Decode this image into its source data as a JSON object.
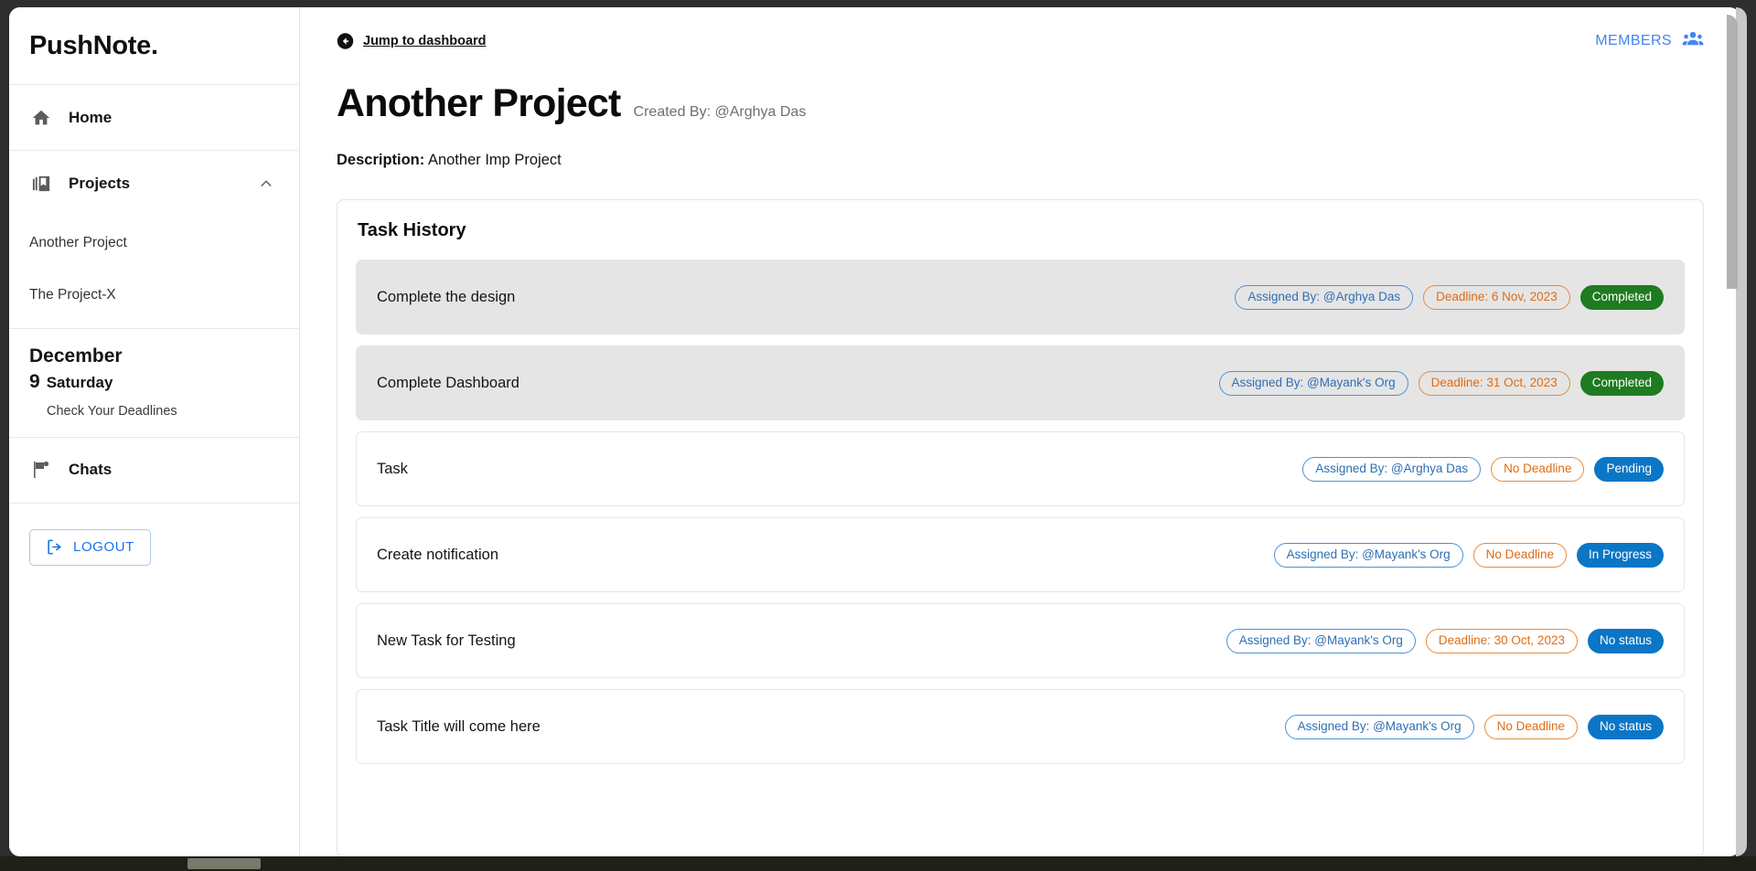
{
  "brand": {
    "name": "PushNote."
  },
  "sidebar": {
    "home": {
      "label": "Home",
      "icon": "home-icon"
    },
    "projects": {
      "label": "Projects",
      "icon": "library-books-icon",
      "chevron": "chevron-up-icon"
    },
    "project_items": [
      {
        "label": "Another Project"
      },
      {
        "label": "The Project-X"
      }
    ],
    "date": {
      "month": "December",
      "day_number": "9",
      "day_name": "Saturday",
      "note": "Check Your Deadlines"
    },
    "chats": {
      "label": "Chats",
      "icon": "chat-flag-icon"
    },
    "logout": {
      "label": "LOGOUT",
      "icon": "logout-icon"
    }
  },
  "topbar": {
    "jump_link": "Jump to dashboard",
    "back_icon": "arrow-back-circle-icon",
    "members_label": "MEMBERS",
    "members_icon": "people-group-icon"
  },
  "header": {
    "project_title": "Another Project",
    "created_by": "Created By: @Arghya Das",
    "description_label": "Description:",
    "description_value": "Another Imp Project"
  },
  "task_card": {
    "title": "Task History",
    "rows": [
      {
        "title": "Complete the design",
        "assigned": "Assigned By: @Arghya Das",
        "deadline": "Deadline: 6 Nov, 2023",
        "status": "Completed",
        "status_class": "st-completed",
        "row_class": "done"
      },
      {
        "title": "Complete Dashboard",
        "assigned": "Assigned By: @Mayank's Org",
        "deadline": "Deadline: 31 Oct, 2023",
        "status": "Completed",
        "status_class": "st-completed",
        "row_class": "done"
      },
      {
        "title": "Task",
        "assigned": "Assigned By: @Arghya Das",
        "deadline": "No Deadline",
        "status": "Pending",
        "status_class": "st-pending",
        "row_class": "open"
      },
      {
        "title": "Create notification",
        "assigned": "Assigned By: @Mayank's Org",
        "deadline": "No Deadline",
        "status": "In Progress",
        "status_class": "st-inprogress",
        "row_class": "open"
      },
      {
        "title": "New Task for Testing",
        "assigned": "Assigned By: @Mayank's Org",
        "deadline": "Deadline: 30 Oct, 2023",
        "status": "No status",
        "status_class": "st-nostatus",
        "row_class": "open"
      },
      {
        "title": "Task Title will come here",
        "assigned": "Assigned By: @Mayank's Org",
        "deadline": "No Deadline",
        "status": "No status",
        "status_class": "st-nostatus",
        "row_class": "open"
      }
    ]
  },
  "colors": {
    "accent_blue": "#4285f4",
    "link_blue": "#1a73e8",
    "assigned_border": "#4a90d9",
    "deadline_orange": "#e8893a",
    "status_green": "#1e7b20",
    "status_blue": "#0b76c6",
    "row_done_bg": "#e5e5e5",
    "frame_dark": "#2e2e2e"
  }
}
